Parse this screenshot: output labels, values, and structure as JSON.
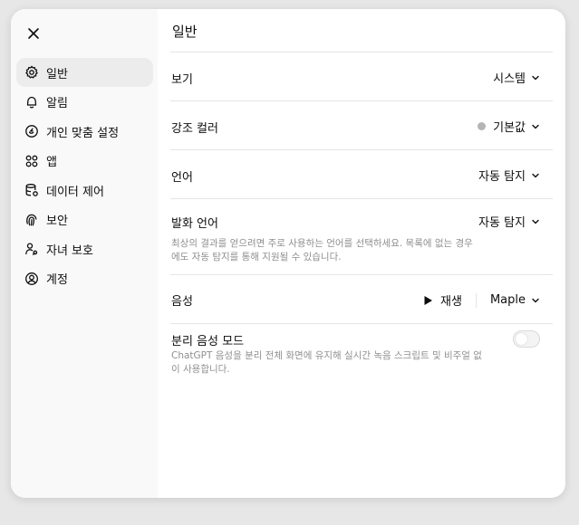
{
  "nav": {
    "close_icon": "close-icon",
    "items": [
      {
        "label": "일반",
        "icon": "gear-icon",
        "active": true
      },
      {
        "label": "알림",
        "icon": "bell-icon",
        "active": false
      },
      {
        "label": "개인 맞춤 설정",
        "icon": "personalization-icon",
        "active": false
      },
      {
        "label": "앱",
        "icon": "apps-icon",
        "active": false
      },
      {
        "label": "데이터 제어",
        "icon": "data-control-icon",
        "active": false
      },
      {
        "label": "보안",
        "icon": "fingerprint-icon",
        "active": false
      },
      {
        "label": "자녀 보호",
        "icon": "parental-control-icon",
        "active": false
      },
      {
        "label": "계정",
        "icon": "account-icon",
        "active": false
      }
    ]
  },
  "main": {
    "title": "일반",
    "settings": {
      "theme": {
        "label": "보기",
        "value": "시스템"
      },
      "accent": {
        "label": "강조 컬러",
        "value": "기본값",
        "dot_color": "#b4b4b4"
      },
      "language": {
        "label": "언어",
        "value": "자동 탐지"
      },
      "spoken_language": {
        "label": "발화 언어",
        "value": "자동 탐지",
        "description_line1": "최상의 결과를 얻으려면 주로 사용하는 언어를 선택하세요. 목록에 없는 경우",
        "description_line2": "에도 자동 탐지를 통해 지원될 수 있습니다."
      },
      "voice": {
        "label": "음성",
        "play_label": "재생",
        "value": "Maple"
      },
      "separate_voice_mode": {
        "label": "분리 음성 모드",
        "enabled": false,
        "description_line1": "ChatGPT 음성을 분리 전체 화면에 유지해 실시간 녹음 스크립트 및 비주얼 없",
        "description_line2": "이 사용합니다."
      }
    }
  },
  "colors": {
    "background": "#e7e7e7",
    "sidebar": "#f9f9f9",
    "active_item": "#ececec",
    "muted_text": "#8f8f8f"
  }
}
